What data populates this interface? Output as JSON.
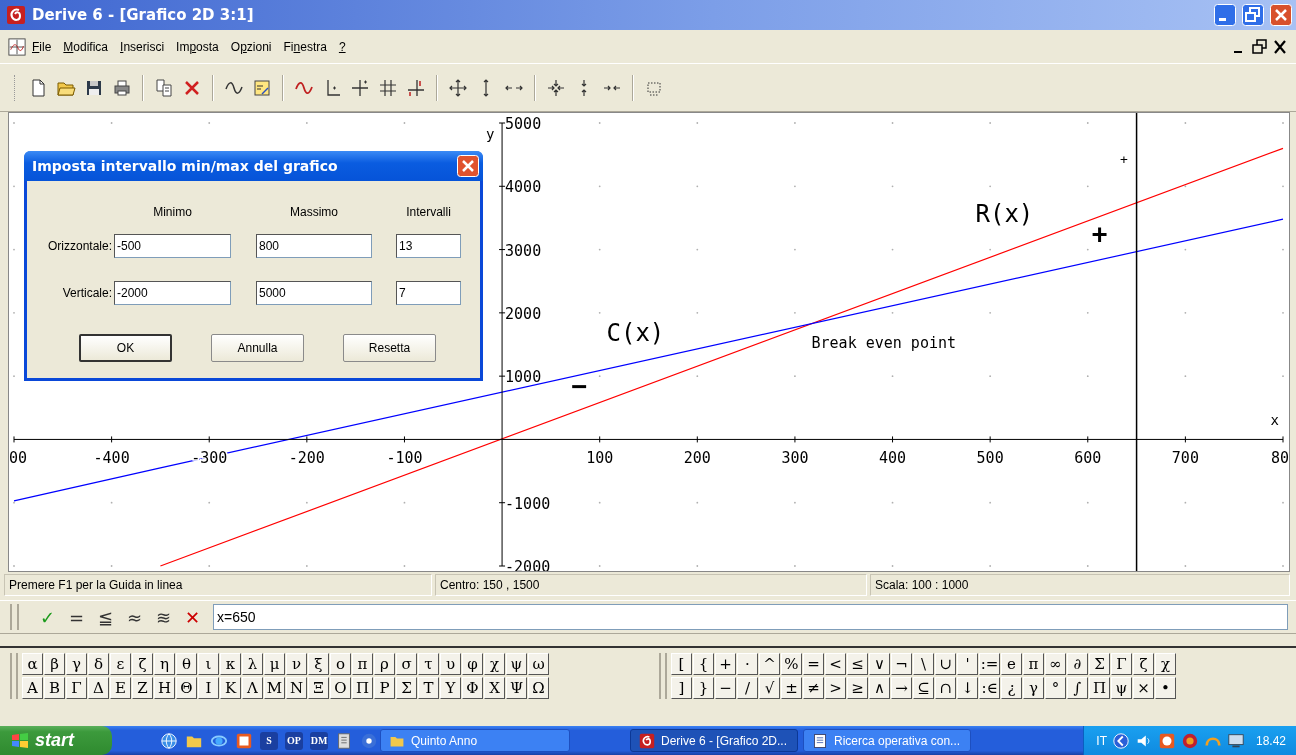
{
  "window": {
    "title": "Derive 6 - [Grafico 2D 3:1]"
  },
  "menu": [
    {
      "key": "F",
      "after": "ile"
    },
    {
      "key": "M",
      "after": "odifica"
    },
    {
      "key": "I",
      "after": "nserisci"
    },
    {
      "before": "Im",
      "key": "p",
      "after": "osta"
    },
    {
      "before": "O",
      "key": "p",
      "after": "zioni"
    },
    {
      "before": "Fi",
      "key": "n",
      "after": "estra"
    },
    {
      "key": "?"
    }
  ],
  "graph": {
    "chart_data": {
      "type": "line",
      "xlabel": "x",
      "ylabel": "y",
      "x": [
        -500,
        -350,
        800
      ],
      "series": [
        {
          "name": "R(x)",
          "color": "#ff0000",
          "values": [
            null,
            -2000,
            4600
          ]
        },
        {
          "name": "C(x)",
          "color": "#0000ff",
          "values": [
            -970,
            -450,
            3480
          ]
        }
      ],
      "xlim": [
        -500,
        800
      ],
      "ylim": [
        -2000,
        5000
      ],
      "xticks": [
        -400,
        -300,
        -200,
        -100,
        100,
        200,
        300,
        400,
        500,
        600,
        700
      ],
      "yticks": [
        -2000,
        -1000,
        1000,
        2000,
        3000,
        4000,
        5000
      ],
      "annotations": [
        "Break even point",
        "+",
        "−",
        "+"
      ],
      "ref_lines": [
        {
          "axis": "x",
          "value": 650
        }
      ]
    },
    "edge_labels": [
      "00",
      "80"
    ]
  },
  "dialog": {
    "title": "Imposta intervallo min/max del grafico",
    "columns": [
      "Minimo",
      "Massimo",
      "Intervalli"
    ],
    "rows": [
      {
        "label": "Orizzontale:",
        "values": [
          "-500",
          "800",
          "13"
        ]
      },
      {
        "label": "Verticale:",
        "values": [
          "-2000",
          "5000",
          "7"
        ]
      }
    ],
    "buttons": [
      {
        "label": "OK",
        "default": true
      },
      {
        "label": "Annulla",
        "default": false
      },
      {
        "label": "Resetta",
        "default": false
      }
    ]
  },
  "status_bar": [
    "Premere F1 per la Guida in linea",
    "Centro: 150 , 1500",
    "Scala: 100 : 1000"
  ],
  "entry": {
    "buttons": [
      {
        "symbol": "✓",
        "color": "#1a9a1a"
      },
      {
        "symbol": "=",
        "color": "#333333"
      },
      {
        "symbol": "≦",
        "color": "#333333"
      },
      {
        "symbol": "≈",
        "color": "#333333"
      },
      {
        "symbol": "≋",
        "color": "#333333"
      },
      {
        "symbol": "✕",
        "color": "#cc0000"
      }
    ],
    "value": "x=650"
  },
  "palettes": [
    {
      "rows": [
        [
          "α",
          "β",
          "γ",
          "δ",
          "ε",
          "ζ",
          "η",
          "θ",
          "ι",
          "κ",
          "λ",
          "μ",
          "ν",
          "ξ",
          "ο",
          "π",
          "ρ",
          "σ",
          "τ",
          "υ",
          "φ",
          "χ",
          "ψ",
          "ω"
        ],
        [
          "A",
          "B",
          "Γ",
          "Δ",
          "E",
          "Z",
          "H",
          "Θ",
          "I",
          "K",
          "Λ",
          "M",
          "N",
          "Ξ",
          "O",
          "Π",
          "P",
          "Σ",
          "T",
          "Y",
          "Φ",
          "X",
          "Ψ",
          "Ω"
        ]
      ]
    },
    {
      "rows": [
        [
          "[",
          "{",
          "+",
          "·",
          "^",
          "%",
          "=",
          "<",
          "≤",
          "∨",
          "¬",
          "\\",
          "∪",
          "'",
          ":=",
          "e",
          "π",
          "∞",
          "∂",
          "Σ",
          "Γ",
          "ζ",
          "χ"
        ],
        [
          "]",
          "}",
          "−",
          "/",
          "√",
          "±",
          "≠",
          ">",
          "≥",
          "∧",
          "→",
          "⊆",
          "∩",
          "↓",
          ":∈",
          "¿",
          "γ",
          "°",
          "∫",
          "Π",
          "ψ",
          "×",
          "•"
        ]
      ]
    }
  ],
  "taskbar": {
    "start": "start",
    "quick_launch": [
      {
        "kind": "globe"
      },
      {
        "kind": "folder"
      },
      {
        "kind": "browser"
      },
      {
        "kind": "calendar"
      },
      {
        "kind": "text",
        "text": "S"
      },
      {
        "kind": "text",
        "text": "OP"
      },
      {
        "kind": "text",
        "text": "DM"
      },
      {
        "kind": "book"
      },
      {
        "kind": "disc"
      }
    ],
    "tasks": [
      {
        "kind": "folder",
        "label": "Quinto Anno",
        "selected": false
      },
      {
        "kind": "derive",
        "label": "Derive 6 - [Grafico 2D...",
        "selected": true
      },
      {
        "kind": "document",
        "label": "Ricerca operativa con...",
        "selected": false
      }
    ],
    "tray": {
      "language": "IT",
      "clock": "18.42"
    }
  }
}
